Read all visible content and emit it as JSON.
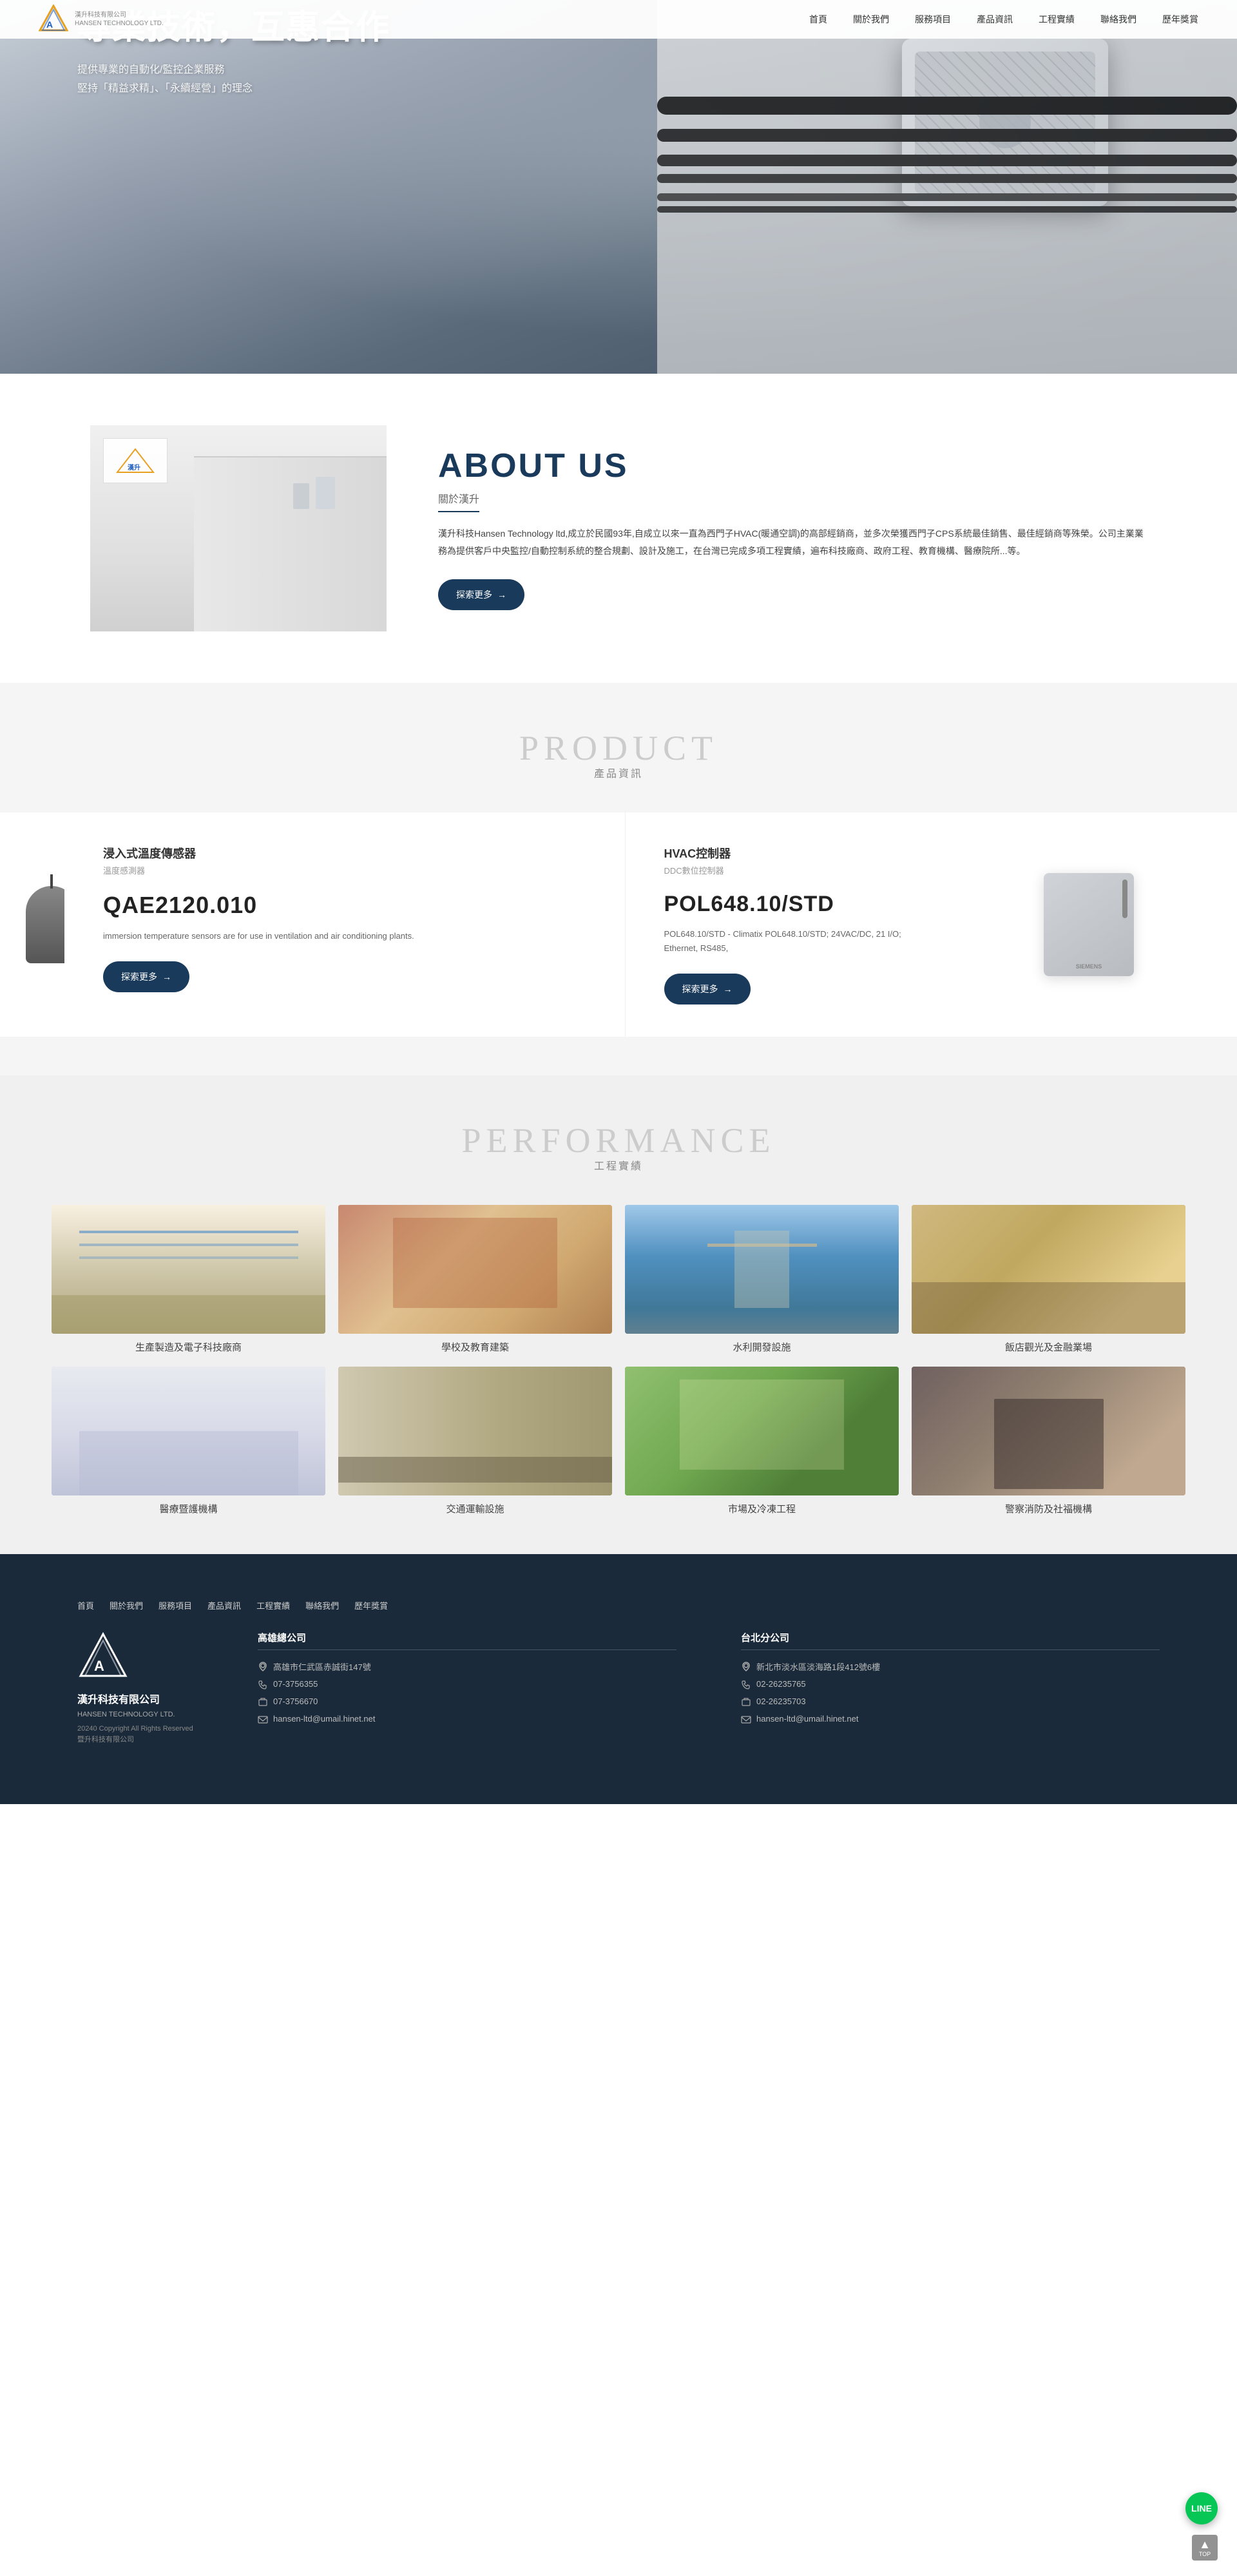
{
  "company": {
    "name_zh": "漢升科技有限公司",
    "name_en": "HANSEN TECHNOLOGY LTD.",
    "copyright": "20240 Copyright All Rights Reserved\n暨升科技有限公司"
  },
  "header": {
    "nav_items": [
      "首頁",
      "關於我們",
      "服務項目",
      "產品資訊",
      "工程實績",
      "聯絡我們",
      "歷年獎賞"
    ]
  },
  "hero": {
    "title": "專業技術，互惠合作",
    "subtitle_line1": "提供專業的自動化/監控企業服務",
    "subtitle_line2": "堅持「精益求精」、「永續經營」的理念"
  },
  "about": {
    "en_title": "ABOUT US",
    "zh_subtitle": "關於漢升",
    "description": "漢升科技Hansen Technology ltd,成立於民國93年,自成立以來一直為西門子HVAC(暖通空調)的高部經銷商，並多次榮獲西門子CPS系統最佳銷售、最佳經銷商等殊榮。公司主業業務為提供客戶中央監控/自動控制系統的整合規劃、設計及施工，在台灣已完成多項工程實績，遍布科技廠商、政府工程、教育機構、醫療院所...等。",
    "button_label": "探索更多"
  },
  "product": {
    "en_title": "PRODUCT",
    "zh_title": "產品資訊",
    "items": [
      {
        "category": "浸入式溫度傳感器",
        "type": "溫度感測器",
        "model": "QAE2120.010",
        "description": "immersion temperature sensors are for use in ventilation and air conditioning plants.",
        "button_label": "探索更多"
      },
      {
        "category": "HVAC控制器",
        "type": "DDC數位控制器",
        "model": "POL648.10/STD",
        "description": "POL648.10/STD - Climatix POL648.10/STD; 24VAC/DC, 21 I/O; Ethernet, RS485,",
        "button_label": "探索更多"
      }
    ]
  },
  "performance": {
    "en_title": "PERFORMANCE",
    "zh_title": "工程實績",
    "items": [
      {
        "label": "生產製造及電子科技廠商",
        "class": "perf-factory"
      },
      {
        "label": "學校及教育建築",
        "class": "perf-school"
      },
      {
        "label": "水利開發設施",
        "class": "perf-water"
      },
      {
        "label": "飯店觀光及金融業場",
        "class": "perf-hotel"
      },
      {
        "label": "醫療暨護機構",
        "class": "perf-hospital"
      },
      {
        "label": "交通運輸設施",
        "class": "perf-traffic"
      },
      {
        "label": "市場及冷凍工程",
        "class": "perf-market"
      },
      {
        "label": "警察消防及社福機構",
        "class": "perf-police"
      }
    ]
  },
  "footer": {
    "nav_items": [
      "首頁",
      "關於我們",
      "服務項目",
      "產品資訊",
      "工程實績",
      "聯絡我們",
      "歷年獎賞"
    ],
    "kaohsiung": {
      "title": "高雄總公司",
      "address": "高雄市仁武區赤誠街147號",
      "tel1": "07-3756355",
      "tel2": "07-3756670",
      "email": "hansen-ltd@umail.hinet.net"
    },
    "taipei": {
      "title": "台北分公司",
      "address": "新北市淡水區淡海路1段412號6樓",
      "tel1": "02-26235765",
      "tel2": "02-26235703",
      "email": "hansen-ltd@umail.hinet.net"
    }
  }
}
